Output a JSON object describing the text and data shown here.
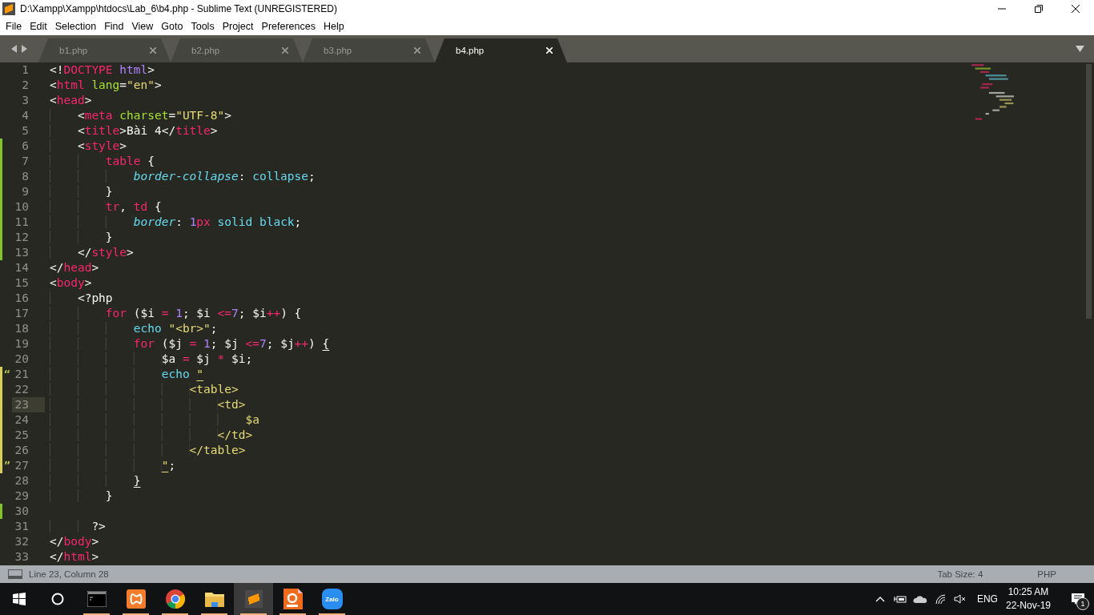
{
  "window": {
    "title": "D:\\Xampp\\Xampp\\htdocs\\Lab_6\\b4.php - Sublime Text (UNREGISTERED)"
  },
  "menu": [
    "File",
    "Edit",
    "Selection",
    "Find",
    "View",
    "Goto",
    "Tools",
    "Project",
    "Preferences",
    "Help"
  ],
  "tabs": [
    {
      "label": "b1.php",
      "selected": false
    },
    {
      "label": "b2.php",
      "selected": false
    },
    {
      "label": "b3.php",
      "selected": false
    },
    {
      "label": "b4.php",
      "selected": true
    }
  ],
  "editor": {
    "lines": [
      {
        "number": "1",
        "current": false,
        "tokens": [
          {
            "text": "<!",
            "kind": "punct"
          },
          {
            "text": "DOCTYPE ",
            "kind": "tag"
          },
          {
            "text": "html",
            "kind": "constant"
          },
          {
            "text": ">",
            "kind": "punct"
          }
        ]
      },
      {
        "number": "2",
        "current": false,
        "tokens": [
          {
            "text": "<",
            "kind": "punct"
          },
          {
            "text": "html ",
            "kind": "tag"
          },
          {
            "text": "lang",
            "kind": "attr"
          },
          {
            "text": "=",
            "kind": "punct"
          },
          {
            "text": "\"en\"",
            "kind": "string"
          },
          {
            "text": ">",
            "kind": "punct"
          }
        ]
      },
      {
        "number": "3",
        "current": false,
        "tokens": [
          {
            "text": "<",
            "kind": "punct"
          },
          {
            "text": "head",
            "kind": "tag"
          },
          {
            "text": ">",
            "kind": "punct"
          }
        ]
      },
      {
        "number": "4",
        "current": false,
        "tokens": [
          {
            "text": "    <",
            "kind": "punct"
          },
          {
            "text": "meta ",
            "kind": "tag"
          },
          {
            "text": "charset",
            "kind": "attr"
          },
          {
            "text": "=",
            "kind": "punct"
          },
          {
            "text": "\"UTF-8\"",
            "kind": "string"
          },
          {
            "text": ">",
            "kind": "punct"
          }
        ]
      },
      {
        "number": "5",
        "current": false,
        "tokens": [
          {
            "text": "    <",
            "kind": "punct"
          },
          {
            "text": "title",
            "kind": "tag"
          },
          {
            "text": ">Bài 4</",
            "kind": "punct"
          },
          {
            "text": "title",
            "kind": "tag"
          },
          {
            "text": ">",
            "kind": "punct"
          }
        ]
      },
      {
        "number": "6",
        "current": false,
        "color": "#7fc42b",
        "tokens": [
          {
            "text": "    <",
            "kind": "punct"
          },
          {
            "text": "style",
            "kind": "tag"
          },
          {
            "text": ">",
            "kind": "punct"
          }
        ]
      },
      {
        "number": "7",
        "current": false,
        "color": "#7fc42b",
        "tokens": [
          {
            "text": "        table",
            "kind": "tag"
          },
          {
            "text": " {",
            "kind": "punct"
          }
        ]
      },
      {
        "number": "8",
        "current": false,
        "color": "#7fc42b",
        "tokens": [
          {
            "text": "            border-collapse",
            "kind": "property"
          },
          {
            "text": ": ",
            "kind": "punct"
          },
          {
            "text": "collapse",
            "kind": "value"
          },
          {
            "text": ";",
            "kind": "punct"
          }
        ]
      },
      {
        "number": "9",
        "current": false,
        "color": "#7fc42b",
        "tokens": [
          {
            "text": "        }",
            "kind": "punct"
          }
        ]
      },
      {
        "number": "10",
        "current": false,
        "color": "#7fc42b",
        "tokens": [
          {
            "text": "        tr",
            "kind": "tag"
          },
          {
            "text": ", ",
            "kind": "punct"
          },
          {
            "text": "td",
            "kind": "tag"
          },
          {
            "text": " {",
            "kind": "punct"
          }
        ]
      },
      {
        "number": "11",
        "current": false,
        "color": "#7fc42b",
        "tokens": [
          {
            "text": "            border",
            "kind": "property"
          },
          {
            "text": ": ",
            "kind": "punct"
          },
          {
            "text": "1",
            "kind": "constant"
          },
          {
            "text": "px ",
            "kind": "operator"
          },
          {
            "text": "solid black",
            "kind": "value"
          },
          {
            "text": ";",
            "kind": "punct"
          }
        ]
      },
      {
        "number": "12",
        "current": false,
        "color": "#7fc42b",
        "tokens": [
          {
            "text": "        }",
            "kind": "punct"
          }
        ]
      },
      {
        "number": "13",
        "current": false,
        "color": "#7fc42b",
        "tokens": [
          {
            "text": "    </",
            "kind": "punct"
          },
          {
            "text": "style",
            "kind": "tag"
          },
          {
            "text": ">",
            "kind": "punct"
          }
        ]
      },
      {
        "number": "14",
        "current": false,
        "tokens": [
          {
            "text": "</",
            "kind": "punct"
          },
          {
            "text": "head",
            "kind": "tag"
          },
          {
            "text": ">",
            "kind": "punct"
          }
        ]
      },
      {
        "number": "15",
        "current": false,
        "tokens": [
          {
            "text": "<",
            "kind": "punct"
          },
          {
            "text": "body",
            "kind": "tag"
          },
          {
            "text": ">",
            "kind": "punct"
          }
        ]
      },
      {
        "number": "16",
        "current": false,
        "tokens": [
          {
            "text": "    <?php",
            "kind": "punct"
          }
        ]
      },
      {
        "number": "17",
        "current": false,
        "tokens": [
          {
            "text": "        for",
            "kind": "operator"
          },
          {
            "text": " ($i ",
            "kind": "punct"
          },
          {
            "text": "= ",
            "kind": "operator"
          },
          {
            "text": "1",
            "kind": "constant"
          },
          {
            "text": "; $i ",
            "kind": "punct"
          },
          {
            "text": "<=",
            "kind": "operator"
          },
          {
            "text": "7",
            "kind": "constant"
          },
          {
            "text": "; $i",
            "kind": "punct"
          },
          {
            "text": "++",
            "kind": "operator"
          },
          {
            "text": ") {",
            "kind": "punct"
          }
        ]
      },
      {
        "number": "18",
        "current": false,
        "tokens": [
          {
            "text": "            echo ",
            "kind": "support"
          },
          {
            "text": "\"<br>\"",
            "kind": "string"
          },
          {
            "text": ";",
            "kind": "punct"
          }
        ]
      },
      {
        "number": "19",
        "current": false,
        "tokens": [
          {
            "text": "            for",
            "kind": "operator"
          },
          {
            "text": " ($j ",
            "kind": "punct"
          },
          {
            "text": "= ",
            "kind": "operator"
          },
          {
            "text": "1",
            "kind": "constant"
          },
          {
            "text": "; $j ",
            "kind": "punct"
          },
          {
            "text": "<=",
            "kind": "operator"
          },
          {
            "text": "7",
            "kind": "constant"
          },
          {
            "text": "; $j",
            "kind": "punct"
          },
          {
            "text": "++",
            "kind": "operator"
          },
          {
            "text": ") ",
            "kind": "punct"
          },
          {
            "text": "{",
            "kind": "punct",
            "matched": true
          }
        ]
      },
      {
        "number": "20",
        "current": false,
        "tokens": [
          {
            "text": "                $a ",
            "kind": "punct"
          },
          {
            "text": "=",
            "kind": "operator"
          },
          {
            "text": " $j ",
            "kind": "punct"
          },
          {
            "text": "*",
            "kind": "operator"
          },
          {
            "text": " $i;",
            "kind": "punct"
          }
        ]
      },
      {
        "number": "21",
        "current": false,
        "color": "#d8cf5a",
        "marker": "“",
        "tokens": [
          {
            "text": "                echo ",
            "kind": "support"
          },
          {
            "text": "\"",
            "kind": "string",
            "matched": true
          }
        ]
      },
      {
        "number": "22",
        "current": false,
        "color": "#d8cf5a",
        "tokens": [
          {
            "text": "                    <table>",
            "kind": "string"
          }
        ]
      },
      {
        "number": "23",
        "current": true,
        "color": "#d8cf5a",
        "tokens": [
          {
            "text": "                        <td>",
            "kind": "string"
          }
        ]
      },
      {
        "number": "24",
        "current": false,
        "color": "#d8cf5a",
        "tokens": [
          {
            "text": "                            $a",
            "kind": "string"
          }
        ]
      },
      {
        "number": "25",
        "current": false,
        "color": "#d8cf5a",
        "tokens": [
          {
            "text": "                        </td>",
            "kind": "string"
          }
        ]
      },
      {
        "number": "26",
        "current": false,
        "color": "#d8cf5a",
        "tokens": [
          {
            "text": "                    </table>",
            "kind": "string"
          }
        ]
      },
      {
        "number": "27",
        "current": false,
        "color": "#d8cf5a",
        "marker": "”",
        "tokens": [
          {
            "text": "                \"",
            "kind": "string",
            "matched": true
          },
          {
            "text": ";",
            "kind": "punct"
          }
        ]
      },
      {
        "number": "28",
        "current": false,
        "tokens": [
          {
            "text": "            }",
            "kind": "punct",
            "matched": true
          }
        ]
      },
      {
        "number": "29",
        "current": false,
        "tokens": [
          {
            "text": "        }",
            "kind": "punct"
          }
        ]
      },
      {
        "number": "30",
        "current": false,
        "color": "#7fc42b"
      },
      {
        "number": "31",
        "current": false,
        "tokens": [
          {
            "text": "      ?>",
            "kind": "punct"
          }
        ]
      },
      {
        "number": "32",
        "current": false,
        "tokens": [
          {
            "text": "</",
            "kind": "punct"
          },
          {
            "text": "body",
            "kind": "tag"
          },
          {
            "text": ">",
            "kind": "punct"
          }
        ]
      },
      {
        "number": "33",
        "current": false,
        "tokens": [
          {
            "text": "</",
            "kind": "punct"
          },
          {
            "text": "html",
            "kind": "tag"
          },
          {
            "text": ">",
            "kind": "punct"
          }
        ]
      }
    ]
  },
  "status_bar": {
    "position": "Line 23, Column 28",
    "tab_size": "Tab Size: 4",
    "syntax": "PHP"
  },
  "taskbar": {
    "apps": [
      {
        "kind": "terminal",
        "running": true,
        "selected": false
      },
      {
        "kind": "xampp",
        "running": true,
        "selected": false
      },
      {
        "kind": "chrome",
        "running": true,
        "selected": false
      },
      {
        "kind": "folder",
        "running": true,
        "selected": false
      },
      {
        "kind": "sublime",
        "running": true,
        "selected": true
      },
      {
        "kind": "pdf",
        "running": true,
        "selected": false
      },
      {
        "kind": "chat",
        "label": "Zalo",
        "running": true,
        "selected": false
      }
    ],
    "language": "ENG",
    "time": "10:25 AM",
    "date": "22-Nov-19",
    "notifications": "1"
  }
}
